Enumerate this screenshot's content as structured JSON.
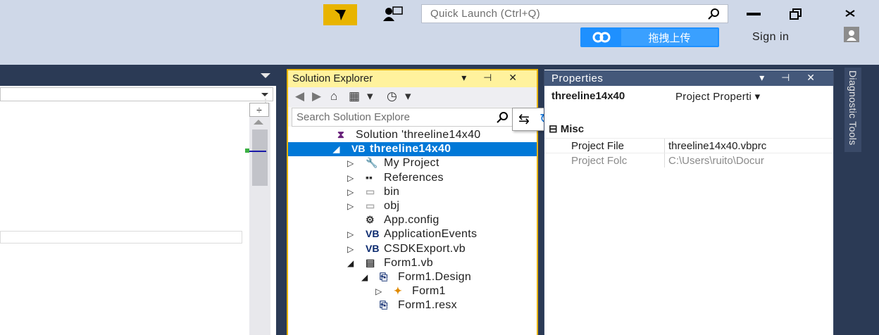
{
  "titlebar": {
    "quick_launch_placeholder": "Quick Launch (Ctrl+Q)",
    "upload_label": "拖拽上传",
    "sign_in": "Sign in"
  },
  "solution_explorer": {
    "title": "Solution Explorer",
    "title_controls": "▾ ⊣ ✕",
    "search_placeholder": "Search Solution Explore",
    "tree": [
      {
        "label": "Solution 'threeline14x40",
        "icon": "solution-icon",
        "expander": "",
        "indent": 0
      },
      {
        "label": "threeline14x40",
        "icon": "vb-project-icon",
        "expander": "◢",
        "indent": 1,
        "selected": true
      },
      {
        "label": "My Project",
        "icon": "wrench-icon",
        "expander": "▷",
        "indent": 2
      },
      {
        "label": "References",
        "icon": "references-icon",
        "expander": "▷",
        "indent": 2
      },
      {
        "label": "bin",
        "icon": "folder-icon",
        "expander": "▷",
        "indent": 2
      },
      {
        "label": "obj",
        "icon": "folder-icon",
        "expander": "▷",
        "indent": 2
      },
      {
        "label": "App.config",
        "icon": "config-icon",
        "expander": "",
        "indent": 2
      },
      {
        "label": "ApplicationEvents",
        "icon": "vb-file-icon",
        "expander": "▷",
        "indent": 2
      },
      {
        "label": "CSDKExport.vb",
        "icon": "vb-file-icon",
        "expander": "▷",
        "indent": 2
      },
      {
        "label": "Form1.vb",
        "icon": "form-icon",
        "expander": "◢",
        "indent": 2
      },
      {
        "label": "Form1.Design",
        "icon": "designer-icon",
        "expander": "◢",
        "indent": 3
      },
      {
        "label": "Form1",
        "icon": "class-icon",
        "expander": "▷",
        "indent": 4
      },
      {
        "label": "Form1.resx",
        "icon": "resx-icon",
        "expander": "",
        "indent": 3
      }
    ]
  },
  "properties": {
    "title": "Properties",
    "title_controls": "▾ ⊣ ✕",
    "object_name": "threeline14x40",
    "object_type": "Project Properti ▾",
    "category": "Misc",
    "rows": [
      {
        "key": "Project File",
        "value": "threeline14x40.vbprc"
      },
      {
        "key": "Project Folc",
        "value": "C:\\Users\\ruito\\Docur"
      }
    ]
  },
  "diagnostic_tab": "Diagnostic Tools",
  "colors": {
    "accent_yellow": "#e8b400",
    "selection_blue": "#0078d7",
    "chrome_dark": "#2b3a55"
  }
}
